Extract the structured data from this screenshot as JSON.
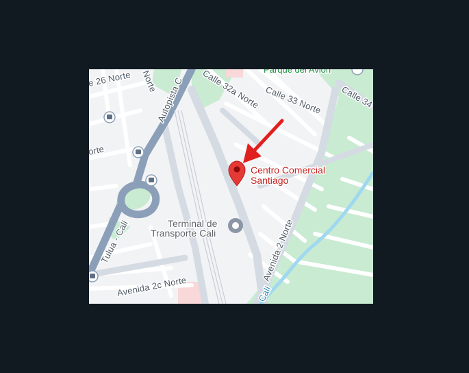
{
  "map": {
    "colors": {
      "background": "#111921",
      "land": "#f2f3f5",
      "major_road": "#d5dbe3",
      "highway": "#8c9fb8",
      "park": "#c8ebd2",
      "water": "#9fd8ef",
      "marker": "#e53935",
      "arrow": "#e0201e"
    },
    "streets": {
      "calle_26_norte": "e 26 Norte",
      "norte_top": "Norte",
      "autopista": "Autopista C",
      "calle_32a_norte": "Calle 32a Norte",
      "calle_33_norte": "Calle 33 Norte",
      "calle_34": "Calle 34",
      "orte_left": "orte",
      "tulua_cali": "Tulua - Cali",
      "avenida_2_norte": "Avenida 2 Norte",
      "avenida_2c_norte": "Avenida 2c Norte",
      "cali_river": "Cali"
    },
    "places": {
      "parque_del_avion": "Parque del Avión",
      "destination_line1": "Centro Comercial",
      "destination_line2": "Santiago",
      "terminal_line1": "Terminal de",
      "terminal_line2": "Transporte Cali"
    },
    "icons": [
      "bus-stop-icon",
      "location-pin-icon",
      "transit-station-icon",
      "direction-arrow-icon"
    ]
  }
}
